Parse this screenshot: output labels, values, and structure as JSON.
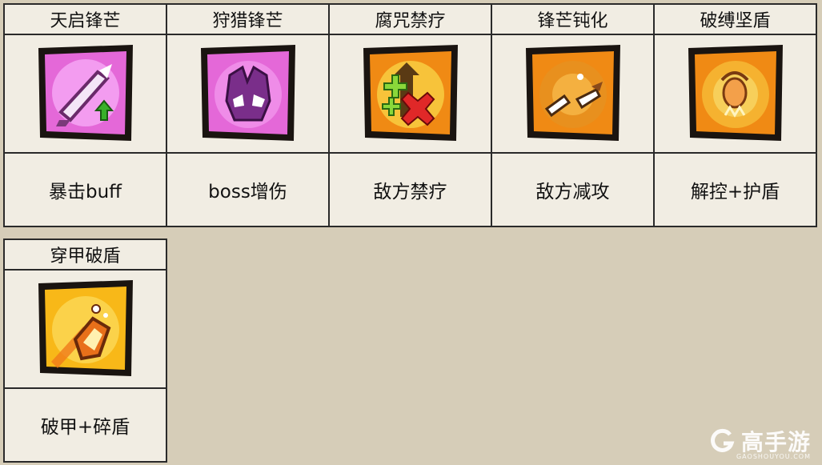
{
  "skills_row1": [
    {
      "name": "天启锋芒",
      "desc": "暴击buff",
      "icon": "sword-crit-icon",
      "theme": "pink"
    },
    {
      "name": "狩猎锋芒",
      "desc": "boss增伤",
      "icon": "monster-claw-icon",
      "theme": "pink"
    },
    {
      "name": "腐咒禁疗",
      "desc": "敌方禁疗",
      "icon": "heal-block-icon",
      "theme": "orange"
    },
    {
      "name": "锋芒钝化",
      "desc": "敌方减攻",
      "icon": "broken-blade-icon",
      "theme": "orange"
    },
    {
      "name": "破缚坚盾",
      "desc": "解控+护盾",
      "icon": "break-free-shield-icon",
      "theme": "orange"
    }
  ],
  "skills_row2": [
    {
      "name": "穿甲破盾",
      "desc": "破甲+碎盾",
      "icon": "armor-pierce-icon",
      "theme": "yellow"
    }
  ],
  "watermark": {
    "text": "高手游",
    "sub": "GAOSHOUYOU.COM"
  },
  "colors": {
    "pink": "#e468d8",
    "orange": "#f08a14",
    "yellow": "#f8b818",
    "background": "#d6cdb8",
    "cell": "#f1ede3"
  }
}
